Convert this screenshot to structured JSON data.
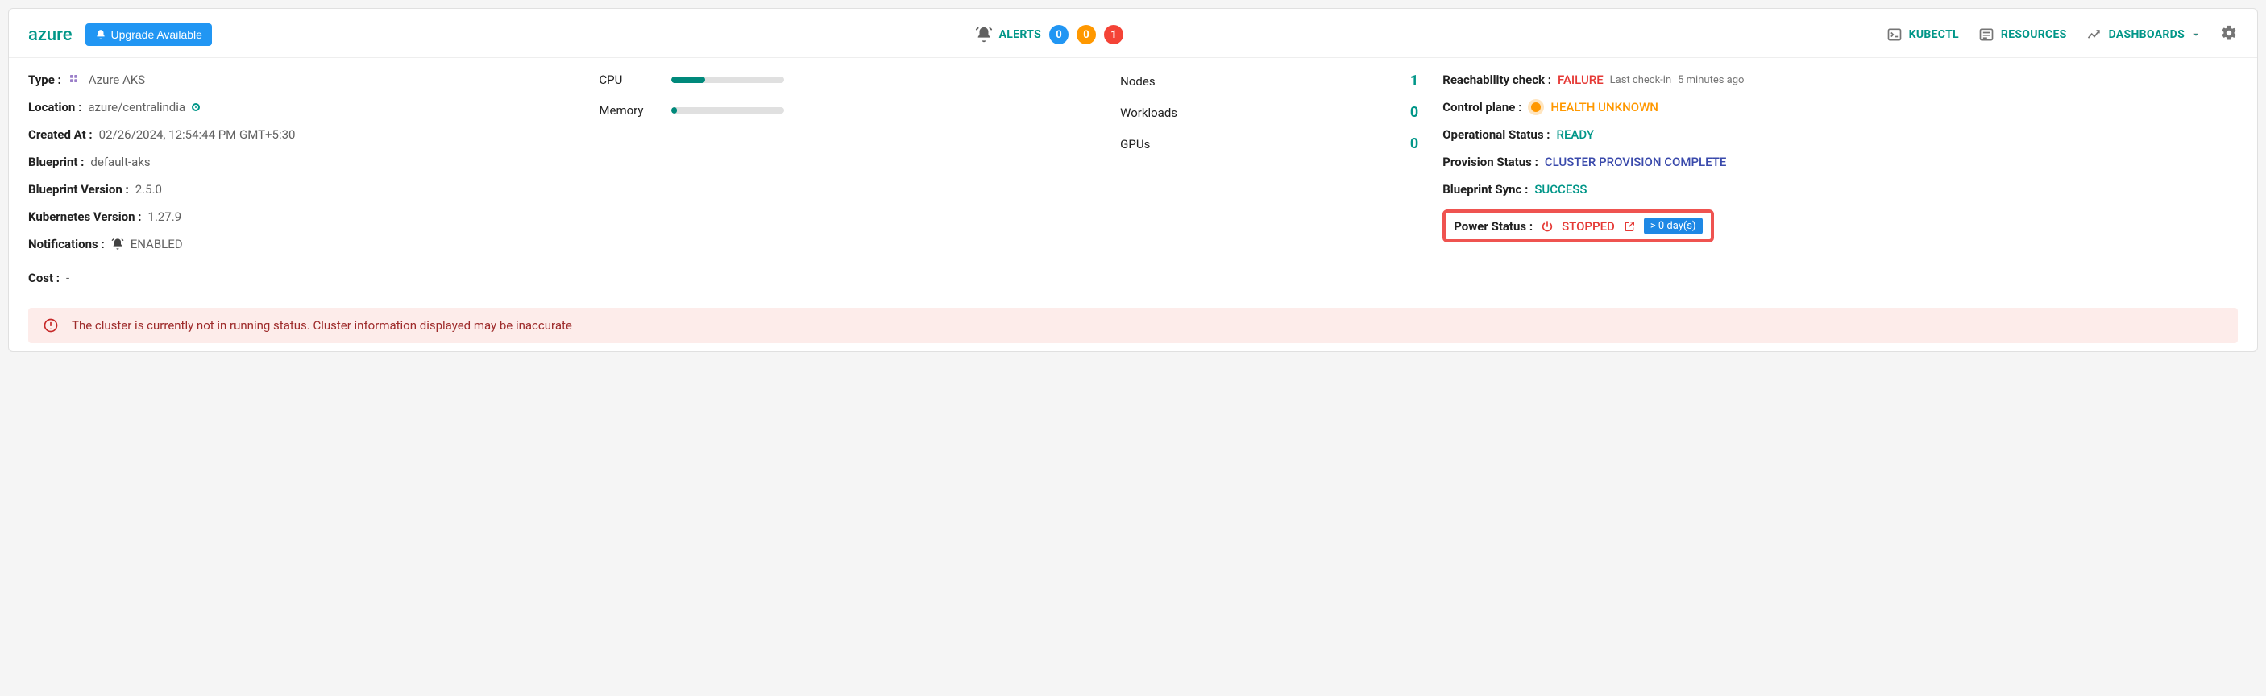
{
  "header": {
    "cluster_name": "azure",
    "upgrade_label": "Upgrade Available",
    "alerts_label": "ALERTS",
    "alerts": {
      "info": "0",
      "warning": "0",
      "error": "1"
    },
    "actions": {
      "kubectl": "KUBECTL",
      "resources": "RESOURCES",
      "dashboards": "DASHBOARDS"
    }
  },
  "details": {
    "type_label": "Type",
    "type_value": "Azure AKS",
    "location_label": "Location",
    "location_value": "azure/centralindia",
    "created_label": "Created At",
    "created_value": "02/26/2024, 12:54:44 PM GMT+5:30",
    "blueprint_label": "Blueprint",
    "blueprint_value": "default-aks",
    "bp_version_label": "Blueprint Version",
    "bp_version_value": "2.5.0",
    "k8s_version_label": "Kubernetes Version",
    "k8s_version_value": "1.27.9",
    "notifications_label": "Notifications",
    "notifications_value": "ENABLED",
    "cost_label": "Cost",
    "cost_value": "-"
  },
  "resources": {
    "cpu_label": "CPU",
    "cpu_pct": 30,
    "memory_label": "Memory",
    "memory_pct": 5
  },
  "counts": {
    "nodes_label": "Nodes",
    "nodes_value": "1",
    "workloads_label": "Workloads",
    "workloads_value": "0",
    "gpus_label": "GPUs",
    "gpus_value": "0"
  },
  "status": {
    "reachability_label": "Reachability check",
    "reachability_value": "FAILURE",
    "last_checkin_label": "Last check-in",
    "last_checkin_value": "5 minutes ago",
    "control_plane_label": "Control plane",
    "control_plane_value": "HEALTH UNKNOWN",
    "operational_label": "Operational Status",
    "operational_value": "READY",
    "provision_label": "Provision Status",
    "provision_value": "CLUSTER PROVISION COMPLETE",
    "bp_sync_label": "Blueprint Sync",
    "bp_sync_value": "SUCCESS",
    "power_label": "Power Status",
    "power_value": "STOPPED",
    "power_days": "> 0 day(s)"
  },
  "banner": {
    "text": "The cluster is currently not in running status. Cluster information displayed may be inaccurate"
  }
}
